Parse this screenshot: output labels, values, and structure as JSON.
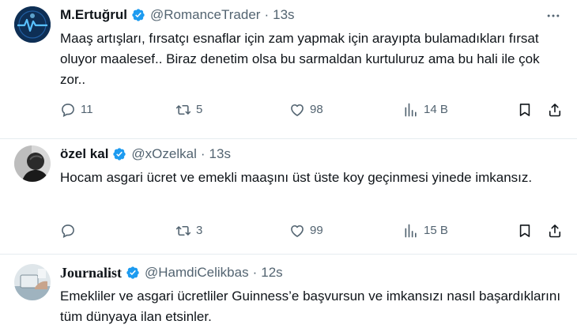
{
  "tweets": [
    {
      "name": "M.Ertuğrul",
      "handle": "@RomanceTrader",
      "time": "13s",
      "text": "Maaş artışları, fırsatçı esnaflar için zam yapmak için arayıpta bulamadıkları fırsat oluyor maalesef.. Biraz denetim olsa bu sarmaldan kurtuluruz ama bu hali ile çok zor..",
      "replies": "11",
      "retweets": "5",
      "likes": "98",
      "views": "14 B",
      "avatar_icon": "heartbeat-avatar"
    },
    {
      "name": "özel kal",
      "handle": "@xOzelkal",
      "time": "13s",
      "text": "Hocam asgari ücret ve emekli maaşını üst üste koy geçinmesi yinede imkansız.",
      "replies": "",
      "retweets": "3",
      "likes": "99",
      "views": "15 B",
      "avatar_icon": "grayscale-portrait-avatar"
    },
    {
      "name": "Journalist",
      "handle": "@HamdiCelikbas",
      "time": "12s",
      "text": "Emekliler ve asgari ücretliler Guinness’e başvursun ve imkansızı nasıl başardıklarını tüm dünyaya ilan etsinler.",
      "avatar_icon": "journalist-photo-avatar"
    }
  ],
  "colors": {
    "verified": "#1d9bf0",
    "muted": "#536471",
    "text": "#0f1419"
  }
}
